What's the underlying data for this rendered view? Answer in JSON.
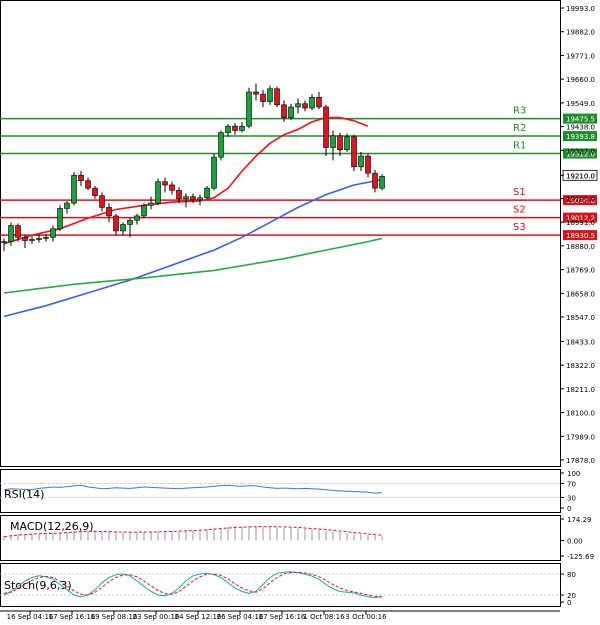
{
  "chart_data": {
    "type": "candlestick",
    "price_panel": {
      "y_ticks": [
        "19993.0",
        "19882.0",
        "19771.0",
        "19660.0",
        "19549.0",
        "19438.0",
        "19327.0",
        "19210.0",
        "19101.0",
        "18991.0",
        "18880.0",
        "18769.0",
        "18658.0",
        "18547.0",
        "18433.0",
        "18322.0",
        "18211.0",
        "18100.0",
        "17989.0",
        "17878.0"
      ],
      "ylim": [
        17878.0,
        19993.0
      ],
      "current_price_label": "19210.0",
      "candles": [
        {
          "o": 18895,
          "h": 18915,
          "l": 18855,
          "c": 18900
        },
        {
          "o": 18900,
          "h": 18990,
          "l": 18880,
          "c": 18975
        },
        {
          "o": 18975,
          "h": 18985,
          "l": 18900,
          "c": 18920
        },
        {
          "o": 18920,
          "h": 18930,
          "l": 18870,
          "c": 18905
        },
        {
          "o": 18905,
          "h": 18925,
          "l": 18890,
          "c": 18910
        },
        {
          "o": 18910,
          "h": 18930,
          "l": 18895,
          "c": 18915
        },
        {
          "o": 18915,
          "h": 18935,
          "l": 18900,
          "c": 18920
        },
        {
          "o": 18920,
          "h": 18975,
          "l": 18900,
          "c": 18960
        },
        {
          "o": 18960,
          "h": 19070,
          "l": 18950,
          "c": 19055
        },
        {
          "o": 19055,
          "h": 19090,
          "l": 19030,
          "c": 19080
        },
        {
          "o": 19080,
          "h": 19225,
          "l": 19070,
          "c": 19210
        },
        {
          "o": 19210,
          "h": 19230,
          "l": 19160,
          "c": 19185
        },
        {
          "o": 19185,
          "h": 19200,
          "l": 19140,
          "c": 19150
        },
        {
          "o": 19150,
          "h": 19160,
          "l": 19100,
          "c": 19115
        },
        {
          "o": 19115,
          "h": 19130,
          "l": 19040,
          "c": 19060
        },
        {
          "o": 19060,
          "h": 19080,
          "l": 18990,
          "c": 19020
        },
        {
          "o": 19020,
          "h": 19030,
          "l": 18930,
          "c": 18950
        },
        {
          "o": 18950,
          "h": 18990,
          "l": 18930,
          "c": 18980
        },
        {
          "o": 18980,
          "h": 19010,
          "l": 18920,
          "c": 19000
        },
        {
          "o": 19000,
          "h": 19030,
          "l": 18980,
          "c": 19020
        },
        {
          "o": 19020,
          "h": 19080,
          "l": 19010,
          "c": 19070
        },
        {
          "o": 19070,
          "h": 19110,
          "l": 19050,
          "c": 19080
        },
        {
          "o": 19080,
          "h": 19195,
          "l": 19070,
          "c": 19180
        },
        {
          "o": 19180,
          "h": 19200,
          "l": 19130,
          "c": 19165
        },
        {
          "o": 19165,
          "h": 19180,
          "l": 19120,
          "c": 19140
        },
        {
          "o": 19140,
          "h": 19155,
          "l": 19080,
          "c": 19100
        },
        {
          "o": 19100,
          "h": 19125,
          "l": 19060,
          "c": 19110
        },
        {
          "o": 19110,
          "h": 19125,
          "l": 19080,
          "c": 19095
        },
        {
          "o": 19095,
          "h": 19120,
          "l": 19070,
          "c": 19105
        },
        {
          "o": 19105,
          "h": 19160,
          "l": 19100,
          "c": 19150
        },
        {
          "o": 19150,
          "h": 19310,
          "l": 19140,
          "c": 19295
        },
        {
          "o": 19295,
          "h": 19420,
          "l": 19280,
          "c": 19410
        },
        {
          "o": 19410,
          "h": 19450,
          "l": 19390,
          "c": 19440
        },
        {
          "o": 19440,
          "h": 19455,
          "l": 19400,
          "c": 19420
        },
        {
          "o": 19420,
          "h": 19460,
          "l": 19410,
          "c": 19440
        },
        {
          "o": 19440,
          "h": 19620,
          "l": 19430,
          "c": 19600
        },
        {
          "o": 19600,
          "h": 19640,
          "l": 19560,
          "c": 19590
        },
        {
          "o": 19590,
          "h": 19610,
          "l": 19530,
          "c": 19555
        },
        {
          "o": 19555,
          "h": 19630,
          "l": 19540,
          "c": 19615
        },
        {
          "o": 19615,
          "h": 19625,
          "l": 19530,
          "c": 19540
        },
        {
          "o": 19540,
          "h": 19560,
          "l": 19460,
          "c": 19480
        },
        {
          "o": 19480,
          "h": 19545,
          "l": 19470,
          "c": 19530
        },
        {
          "o": 19530,
          "h": 19570,
          "l": 19500,
          "c": 19545
        },
        {
          "o": 19545,
          "h": 19560,
          "l": 19510,
          "c": 19525
        },
        {
          "o": 19525,
          "h": 19590,
          "l": 19515,
          "c": 19575
        },
        {
          "o": 19575,
          "h": 19600,
          "l": 19520,
          "c": 19530
        },
        {
          "o": 19530,
          "h": 19540,
          "l": 19300,
          "c": 19340
        },
        {
          "o": 19340,
          "h": 19420,
          "l": 19280,
          "c": 19395
        },
        {
          "o": 19395,
          "h": 19410,
          "l": 19300,
          "c": 19330
        },
        {
          "o": 19330,
          "h": 19405,
          "l": 19320,
          "c": 19390
        },
        {
          "o": 19390,
          "h": 19400,
          "l": 19230,
          "c": 19250
        },
        {
          "o": 19250,
          "h": 19320,
          "l": 19230,
          "c": 19300
        },
        {
          "o": 19300,
          "h": 19310,
          "l": 19200,
          "c": 19220
        },
        {
          "o": 19220,
          "h": 19235,
          "l": 19130,
          "c": 19150
        },
        {
          "o": 19150,
          "h": 19215,
          "l": 19140,
          "c": 19205
        }
      ],
      "moving_averages": [
        {
          "color": "#e8141c",
          "points": [
            [
              0,
              18890
            ],
            [
              4,
              18930
            ],
            [
              8,
              18960
            ],
            [
              12,
              19010
            ],
            [
              16,
              19050
            ],
            [
              20,
              19070
            ],
            [
              24,
              19085
            ],
            [
              28,
              19090
            ],
            [
              30,
              19105
            ],
            [
              32,
              19150
            ],
            [
              34,
              19230
            ],
            [
              36,
              19300
            ],
            [
              38,
              19360
            ],
            [
              40,
              19400
            ],
            [
              42,
              19425
            ],
            [
              44,
              19460
            ],
            [
              46,
              19480
            ],
            [
              48,
              19480
            ],
            [
              50,
              19465
            ],
            [
              52,
              19440
            ]
          ]
        },
        {
          "color": "#3b64d0",
          "points": [
            [
              0,
              18550
            ],
            [
              6,
              18600
            ],
            [
              12,
              18660
            ],
            [
              18,
              18720
            ],
            [
              24,
              18790
            ],
            [
              30,
              18860
            ],
            [
              34,
              18920
            ],
            [
              38,
              18990
            ],
            [
              42,
              19060
            ],
            [
              46,
              19120
            ],
            [
              50,
              19165
            ],
            [
              54,
              19190
            ]
          ]
        },
        {
          "color": "#2ca64a",
          "points": [
            [
              0,
              18660
            ],
            [
              10,
              18700
            ],
            [
              20,
              18730
            ],
            [
              30,
              18765
            ],
            [
              40,
              18820
            ],
            [
              46,
              18860
            ],
            [
              52,
              18900
            ],
            [
              54,
              18915
            ]
          ]
        }
      ],
      "levels": [
        {
          "name": "R3",
          "value": "19475.5",
          "color": "#1f8c2a"
        },
        {
          "name": "R2",
          "value": "19393.8",
          "color": "#1f8c2a"
        },
        {
          "name": "R1",
          "value": "19312.0",
          "color": "#1f8c2a"
        },
        {
          "name": "S1",
          "value": "19094.0",
          "color": "#d4141c"
        },
        {
          "name": "S2",
          "value": "19012.2",
          "color": "#d4141c"
        },
        {
          "name": "S3",
          "value": "18930.5",
          "color": "#d4141c"
        }
      ]
    },
    "rsi_panel": {
      "label": "RSI(14)",
      "y_ticks": [
        "100",
        "70",
        "30",
        "0"
      ],
      "ylim": [
        0,
        100
      ],
      "values": [
        52,
        55,
        54,
        53,
        52,
        56,
        58,
        60,
        59,
        61,
        63,
        65,
        60,
        58,
        55,
        56,
        58,
        57,
        56,
        58,
        60,
        59,
        58,
        57,
        56,
        55,
        57,
        58,
        59,
        60,
        62,
        64,
        65,
        63,
        62,
        64,
        63,
        60,
        58,
        56,
        57,
        56,
        55,
        56,
        55,
        54,
        52,
        50,
        49,
        48,
        47,
        46,
        45,
        42,
        44
      ]
    },
    "macd_panel": {
      "label": "MACD(12,26,9)",
      "y_ticks": [
        "174.29",
        "0.00",
        "-125.69"
      ],
      "ylim": [
        -125.69,
        174.29
      ],
      "histogram": [
        40,
        45,
        48,
        50,
        52,
        55,
        58,
        60,
        64,
        68,
        72,
        75,
        74,
        72,
        70,
        68,
        66,
        65,
        64,
        66,
        68,
        70,
        72,
        74,
        76,
        78,
        80,
        82,
        85,
        90,
        95,
        100,
        105,
        108,
        110,
        112,
        113,
        112,
        110,
        108,
        105,
        102,
        98,
        94,
        90,
        85,
        80,
        74,
        68,
        62,
        56,
        50,
        44,
        38,
        34
      ],
      "signal": [
        30,
        38,
        44,
        48,
        52,
        54,
        56,
        58,
        60,
        64,
        68,
        72,
        74,
        74,
        73,
        71,
        70,
        68,
        67,
        67,
        68,
        69,
        70,
        72,
        74,
        76,
        78,
        80,
        83,
        87,
        92,
        97,
        101,
        105,
        108,
        110,
        112,
        113,
        113,
        112,
        110,
        108,
        105,
        101,
        97,
        93,
        88,
        83,
        77,
        71,
        65,
        59,
        53,
        48,
        42
      ]
    },
    "stoch_panel": {
      "label": "Stoch(9,6,3)",
      "y_ticks": [
        "80",
        "20",
        "0"
      ],
      "ylim": [
        0,
        100
      ],
      "k": [
        20,
        30,
        45,
        60,
        70,
        75,
        72,
        65,
        50,
        35,
        20,
        15,
        20,
        35,
        55,
        70,
        78,
        80,
        75,
        60,
        45,
        30,
        20,
        18,
        25,
        40,
        60,
        75,
        80,
        82,
        78,
        70,
        55,
        40,
        30,
        25,
        30,
        50,
        70,
        82,
        85,
        86,
        84,
        80,
        74,
        65,
        50,
        38,
        30,
        28,
        26,
        20,
        15,
        12,
        16
      ],
      "d": [
        25,
        28,
        38,
        50,
        62,
        70,
        73,
        70,
        60,
        46,
        32,
        22,
        20,
        28,
        42,
        58,
        70,
        77,
        78,
        72,
        60,
        46,
        33,
        24,
        22,
        30,
        45,
        60,
        72,
        80,
        80,
        76,
        66,
        52,
        40,
        32,
        28,
        38,
        55,
        70,
        80,
        84,
        85,
        83,
        79,
        72,
        62,
        50,
        40,
        33,
        29,
        25,
        20,
        16,
        15
      ]
    },
    "x_ticks": [
      {
        "label": "16 Sep 04:16",
        "index": 0
      },
      {
        "label": "17 Sep 16:16",
        "index": 6
      },
      {
        "label": "19 Sep 08:16",
        "index": 12
      },
      {
        "label": "23 Sep 00:16",
        "index": 18
      },
      {
        "label": "24 Sep 12:16",
        "index": 24
      },
      {
        "label": "26 Sep 04:16",
        "index": 30
      },
      {
        "label": "27 Sep 16:16",
        "index": 36
      },
      {
        "label": "1 Oct 08:16",
        "index": 42
      },
      {
        "label": "3 Oct 00:16",
        "index": 48
      }
    ]
  }
}
